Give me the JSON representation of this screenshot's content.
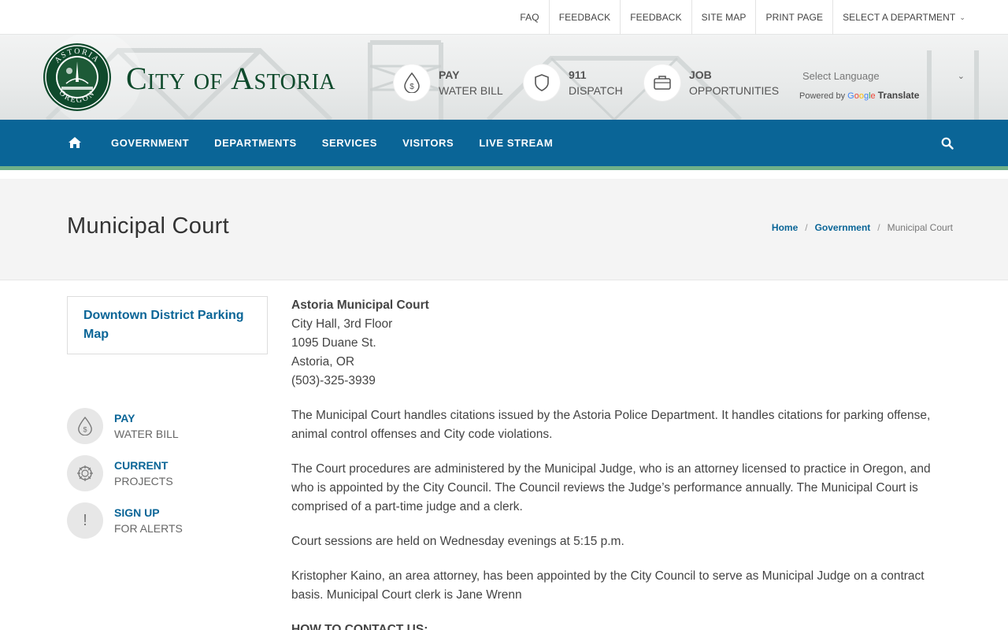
{
  "topbar": {
    "links": [
      "FAQ",
      "FEEDBACK",
      "FEEDBACK",
      "SITE MAP",
      "PRINT PAGE"
    ],
    "department_label": "SELECT A DEPARTMENT"
  },
  "header": {
    "logo_text_city": "City of",
    "logo_text_name": "Astoria",
    "seal_top_text": "ASTORIA",
    "seal_bottom_text": "OREGON",
    "quick_links": [
      {
        "top": "PAY",
        "bottom": "WATER BILL",
        "icon": "water-drop-dollar-icon"
      },
      {
        "top": "911",
        "bottom": "DISPATCH",
        "icon": "shield-icon"
      },
      {
        "top": "JOB",
        "bottom": "OPPORTUNITIES",
        "icon": "briefcase-icon"
      }
    ],
    "language": {
      "placeholder": "Select Language",
      "powered_by": "Powered by",
      "translate": "Translate"
    }
  },
  "nav": {
    "items": [
      "GOVERNMENT",
      "DEPARTMENTS",
      "SERVICES",
      "VISITORS",
      "LIVE STREAM"
    ]
  },
  "page": {
    "title": "Municipal Court",
    "breadcrumb": [
      "Home",
      "Government",
      "Municipal Court"
    ]
  },
  "sidebar": {
    "box_link": "Downtown District Parking Map",
    "quick_links": [
      {
        "top": "PAY",
        "bottom": "WATER BILL",
        "icon": "water-drop-dollar-icon"
      },
      {
        "top": "CURRENT",
        "bottom": "PROJECTS",
        "icon": "globe-gear-icon"
      },
      {
        "top": "SIGN UP",
        "bottom": "FOR ALERTS",
        "icon": "exclamation-icon"
      }
    ]
  },
  "content": {
    "address": {
      "name": "Astoria Municipal Court",
      "line1": "City Hall, 3rd Floor",
      "line2": "1095 Duane St.",
      "line3": "Astoria, OR",
      "phone": "(503)-325-3939"
    },
    "paragraphs": [
      "The Municipal Court handles citations issued by the Astoria Police Department. It  handles  citations for parking offense, animal control offenses and City code violations.",
      "The Court procedures are administered by the Municipal Judge, who is an attorney licensed to practice in Oregon, and who is appointed by the City Council. The Council reviews the Judge’s performance annually. The Municipal Court is comprised of a part-time judge and a clerk.",
      "Court sessions are held on Wednesday evenings at 5:15 p.m.",
      "Kristopher Kaino, an area attorney, has been appointed by the City Council to serve as Municipal Judge on a contract basis.  Municipal Court clerk is Jane Wrenn"
    ],
    "contact_heading": "HOW TO CONTACT US:"
  },
  "colors": {
    "nav_blue": "#0a6597",
    "nav_stripe": "#6fb089",
    "logo_green": "#0f4a2c"
  }
}
